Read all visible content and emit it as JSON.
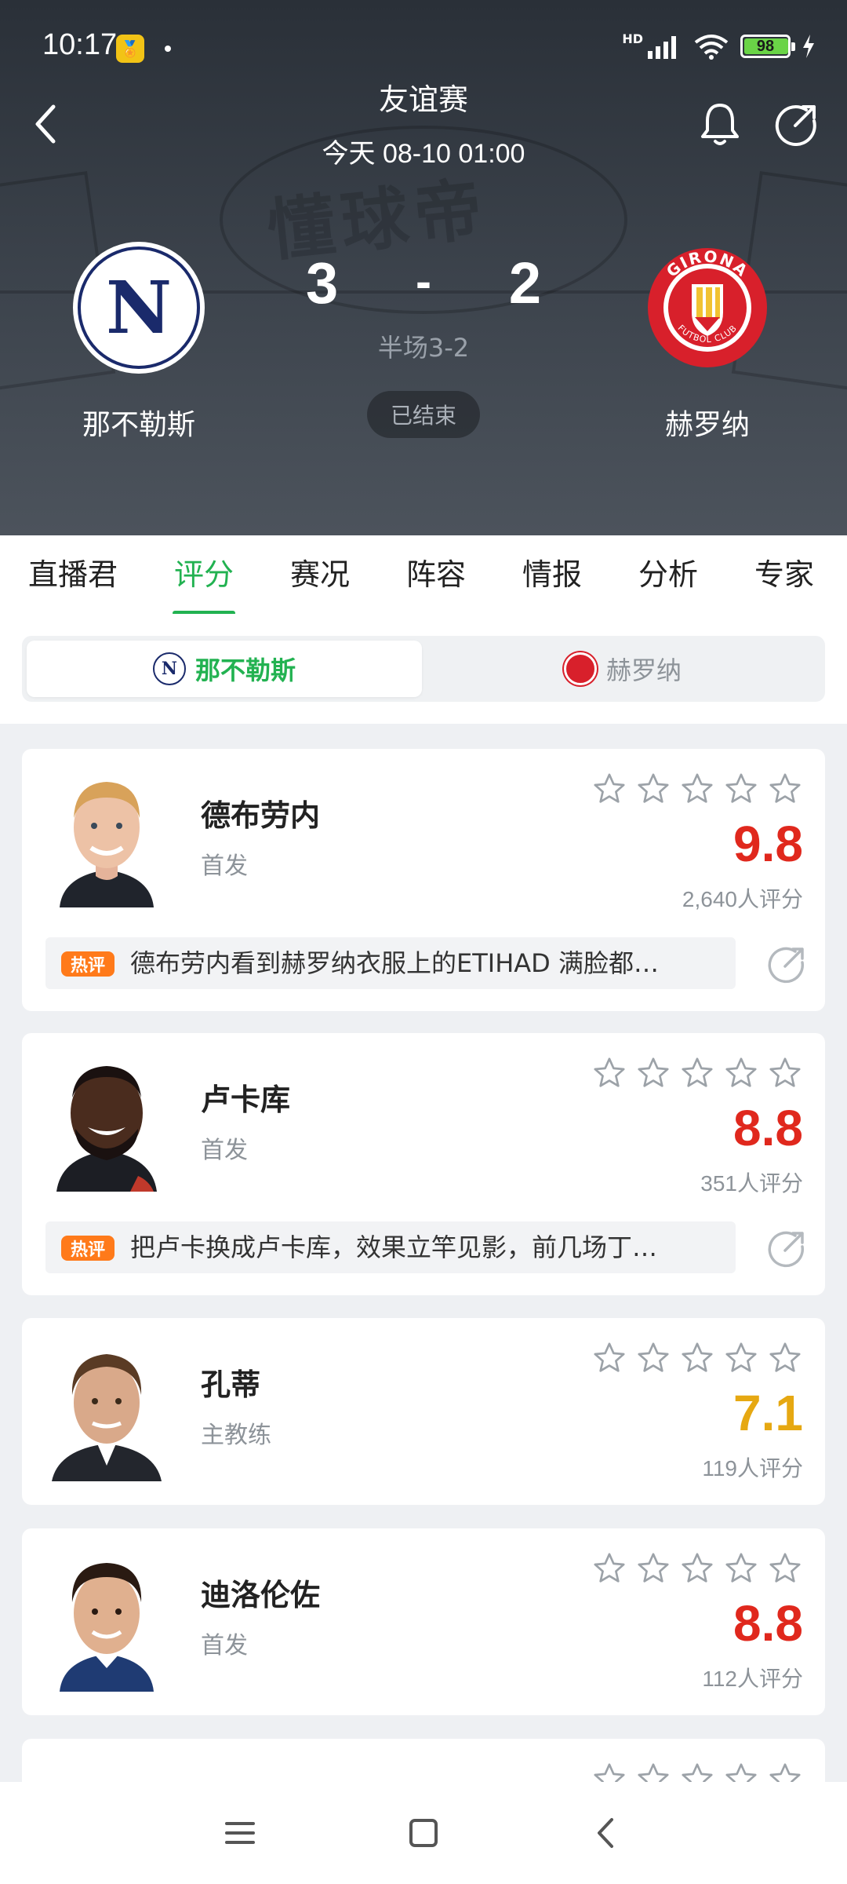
{
  "status_bar": {
    "time": "10:17",
    "hd_label": "HD",
    "battery": "98"
  },
  "match": {
    "title": "友谊赛",
    "datetime": "今天 08-10 01:00",
    "home_team": "那不勒斯",
    "away_team": "赫罗纳",
    "home_score": "3",
    "away_score": "2",
    "separator": "-",
    "halftime": "半场3-2",
    "status": "已结束",
    "home_logo_letter": "N",
    "away_logo_text": "GIRONA",
    "away_logo_subtext": "FUTBOL CLUB"
  },
  "tabs": [
    "直播君",
    "评分",
    "赛况",
    "阵容",
    "情报",
    "分析",
    "专家"
  ],
  "active_tab": "评分",
  "team_toggle": {
    "home": "那不勒斯",
    "away": "赫罗纳",
    "active": "那不勒斯"
  },
  "players": [
    {
      "name": "德布劳内",
      "role": "首发",
      "rating": "9.8",
      "rating_count": "2,640人评分",
      "hot_label": "热评",
      "hot_comment": "德布劳内看到赫罗纳衣服上的ETIHAD 满脸都…"
    },
    {
      "name": "卢卡库",
      "role": "首发",
      "rating": "8.8",
      "rating_count": "351人评分",
      "hot_label": "热评",
      "hot_comment": "把卢卡换成卢卡库，效果立竿见影，前几场丁…"
    },
    {
      "name": "孔蒂",
      "role": "主教练",
      "rating": "7.1",
      "rating_count": "119人评分"
    },
    {
      "name": "迪洛伦佐",
      "role": "首发",
      "rating": "8.8",
      "rating_count": "112人评分"
    }
  ],
  "colors": {
    "accent": "#22b251",
    "rating_high": "#e0281d",
    "rating_mid": "#e6a812",
    "hot_badge": "#ff7a1a"
  },
  "icons": {
    "back": "chevron-left-icon",
    "bell": "bell-icon",
    "share": "share-icon",
    "star": "star-outline-icon"
  }
}
